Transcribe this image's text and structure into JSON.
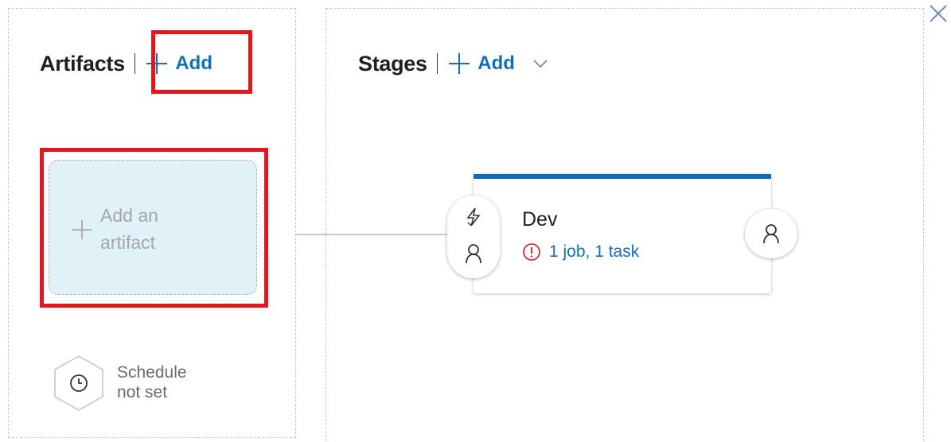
{
  "artifacts": {
    "title": "Artifacts",
    "add_label": "Add",
    "placeholder_line1": "Add an",
    "placeholder_line2": "artifact",
    "schedule_line1": "Schedule",
    "schedule_line2": "not set"
  },
  "stages": {
    "title": "Stages",
    "add_label": "Add",
    "stage": {
      "name": "Dev",
      "status": "1 job, 1 task"
    }
  },
  "colors": {
    "accent": "#106ebe",
    "stage_bar": "#0f6cbd",
    "highlight": "#e3161b",
    "artifact_bg": "#e1f1f8",
    "warning": "#d13438"
  },
  "icons": {
    "close": "close-icon",
    "add": "plus-icon",
    "schedule": "clock-icon",
    "pre_trigger": "lightning-icon",
    "pre_approval": "person-icon",
    "post_approval": "person-icon",
    "status": "error-circle-icon",
    "dropdown": "chevron-down-icon"
  }
}
